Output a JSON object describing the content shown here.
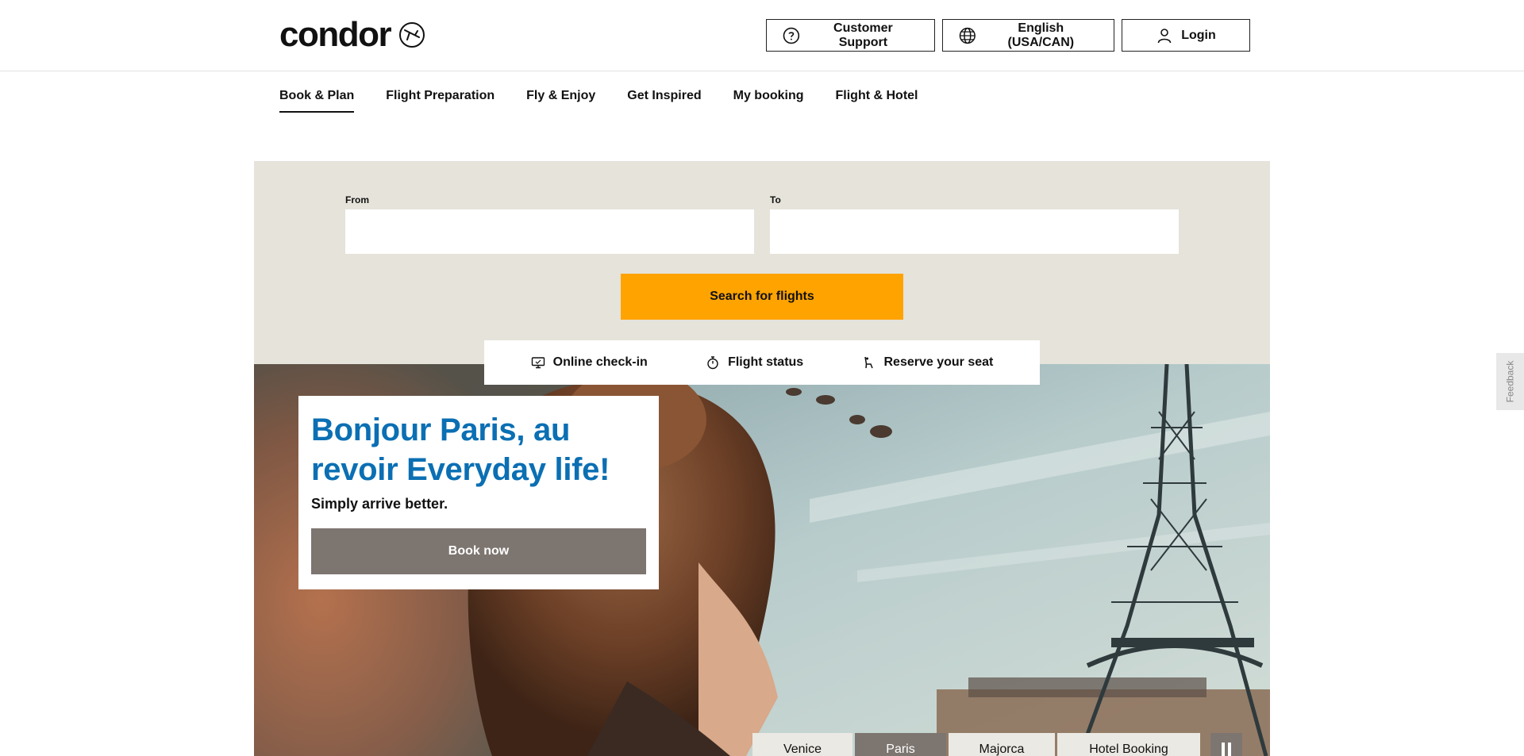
{
  "header": {
    "logo_text": "condor",
    "support_label": "Customer Support",
    "language_label": "English (USA/CAN)",
    "login_label": "Login"
  },
  "nav": {
    "items": [
      {
        "label": "Book & Plan",
        "active": true
      },
      {
        "label": "Flight Preparation"
      },
      {
        "label": "Fly & Enjoy"
      },
      {
        "label": "Get Inspired"
      },
      {
        "label": "My booking"
      },
      {
        "label": "Flight & Hotel"
      }
    ]
  },
  "booking": {
    "from_label": "From",
    "from_value": "",
    "to_label": "To",
    "to_value": "",
    "search_label": "Search for flights"
  },
  "quicklinks": [
    {
      "label": "Online check-in",
      "icon": "monitor-icon"
    },
    {
      "label": "Flight status",
      "icon": "stopwatch-icon"
    },
    {
      "label": "Reserve your seat",
      "icon": "seat-icon"
    }
  ],
  "promo": {
    "title": "Bonjour Paris, au revoir Everyday life!",
    "subtitle": "Simply arrive better.",
    "cta_label": "Book now"
  },
  "carousel": {
    "tabs": [
      {
        "label": "Venice"
      },
      {
        "label": "Paris",
        "active": true
      },
      {
        "label": "Majorca"
      },
      {
        "label": "Hotel Booking"
      }
    ]
  },
  "feedback_label": "Feedback",
  "colors": {
    "accent": "#ffa300",
    "brand_blue": "#0b6fb3",
    "panel": "#e5e3da",
    "button_taupe": "#7d7570"
  }
}
